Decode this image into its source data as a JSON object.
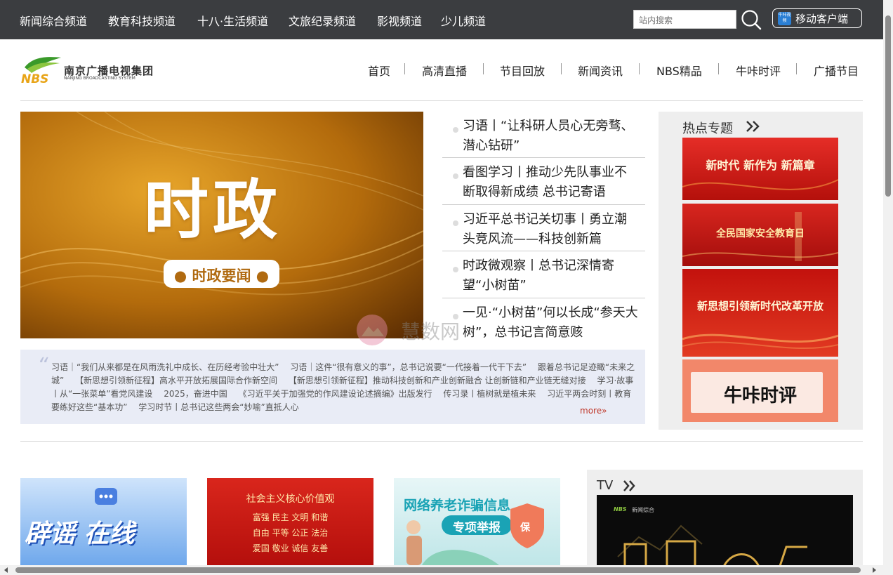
{
  "topbar": {
    "channels": [
      "新闻综合频道",
      "教育科技频道",
      "十八·生活频道",
      "文旅纪录频道",
      "影视频道",
      "少儿频道"
    ],
    "search_placeholder": "站内搜索",
    "mobile_icon_text": "牛咔视频",
    "mobile_label": "移动客户端",
    "icons": {
      "search": "search-icon",
      "mobile": "mobile-app-icon"
    }
  },
  "header": {
    "logo_mark": "NBS",
    "logo_name_cn": "南京广播电视集团",
    "logo_name_en": "NANJING BROADCASTING SYSTEM",
    "nav": [
      "首页",
      "高清直播",
      "节目回放",
      "新闻资讯",
      "NBS精品",
      "牛咔时评",
      "广播节目"
    ]
  },
  "banner": {
    "title": "时政",
    "subtitle": "● 时政要闻 ●"
  },
  "news": [
    "习语丨“让科研人员心无旁骛、潜心钻研”",
    "看图学习丨推动少先队事业不断取得新成绩 总书记寄语",
    "习近平总书记关切事丨勇立潮头竞风流——科技创新篇",
    "时政微观察丨总书记深情寄望“小树苗”",
    "一见·“小树苗”何以长成“参天大树”，总书记言简意赅"
  ],
  "ticker": {
    "text": "习语｜“我们从来都是在风雨洗礼中成长、在历经考验中壮大”　 习语｜这件“很有意义的事”，总书记说要“一代接着一代干下去”　 跟着总书记足迹瞰“未来之城”　 【新思想引领新征程】高水平开放拓展国际合作新空间　 【新思想引领新征程】推动科技创新和产业创新融合 让创新链和产业链无缝对接　 学习·故事丨从“一张菜单”看党风建设　 2025，奋进中国　 《习近平关于加强党的作风建设论述摘编》出版发行　 传习录丨植树就是植未来　 习近平两会时刻丨教育要练好这些“基本功”　 学习时节丨总书记这些两会“妙喻”直抵人心",
    "more": "more»"
  },
  "hot": {
    "title": "热点专题",
    "cards": [
      "新时代 新作为 新篇章",
      "全民国家安全教育日",
      "新思想引领新时代改革开放",
      "牛咔时评"
    ]
  },
  "bottom": {
    "cards": [
      {
        "title": "辟谣 在线"
      },
      {
        "title": "社会主义核心价值观",
        "lines": [
          "富强 民主 文明 和谐",
          "自由 平等 公正 法治",
          "爱国 敬业 诚信 友善"
        ]
      },
      {
        "title": "网络养老诈骗信息",
        "sub": "专项举报",
        "badge": "保"
      }
    ],
    "tv_title": "TV",
    "tv_logo": "NBS",
    "tv_channel": "新闻综合"
  },
  "watermark": {
    "cn": "慧数网"
  },
  "colors": {
    "topbar": "#3b3d40",
    "accent_red": "#d7261e",
    "gold": "#c98a12",
    "ticker_bg": "#e9ecf6",
    "panel_bg": "#eeeeee"
  }
}
